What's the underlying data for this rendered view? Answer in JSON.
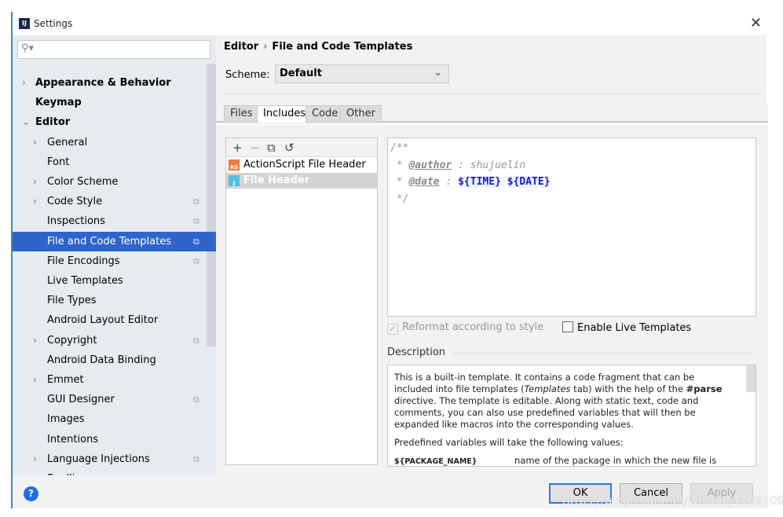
{
  "window": {
    "title": "Settings",
    "close": "✕"
  },
  "sidebar": {
    "search_placeholder": "",
    "items": [
      {
        "label": "Appearance & Behavior",
        "arrow": "›",
        "bold": true
      },
      {
        "label": "Keymap",
        "bold": true
      },
      {
        "label": "Editor",
        "arrow": "⌄",
        "bold": true
      },
      {
        "label": "General",
        "arrow": "›"
      },
      {
        "label": "Font"
      },
      {
        "label": "Color Scheme",
        "arrow": "›"
      },
      {
        "label": "Code Style",
        "arrow": "›",
        "copy": true
      },
      {
        "label": "Inspections",
        "copy": true
      },
      {
        "label": "File and Code Templates",
        "copy": true,
        "selected": true
      },
      {
        "label": "File Encodings",
        "copy": true
      },
      {
        "label": "Live Templates"
      },
      {
        "label": "File Types"
      },
      {
        "label": "Android Layout Editor"
      },
      {
        "label": "Copyright",
        "arrow": "›",
        "copy": true
      },
      {
        "label": "Android Data Binding"
      },
      {
        "label": "Emmet",
        "arrow": "›"
      },
      {
        "label": "GUI Designer",
        "copy": true
      },
      {
        "label": "Images"
      },
      {
        "label": "Intentions"
      },
      {
        "label": "Language Injections",
        "arrow": "›",
        "copy": true
      },
      {
        "label": "Spelling",
        "copy": true
      }
    ]
  },
  "main": {
    "breadcrumb": [
      "Editor",
      "File and Code Templates"
    ],
    "scheme_label": "Scheme:",
    "scheme_value": "Default",
    "tabs": [
      {
        "label": "Files"
      },
      {
        "label": "Includes",
        "active": true
      },
      {
        "label": "Code"
      },
      {
        "label": "Other"
      }
    ],
    "templates": [
      {
        "label": "ActionScript File Header",
        "icon": "AS",
        "color": "#f07b3f"
      },
      {
        "label": "File Header",
        "icon": "J",
        "color": "#5bbcdc",
        "selected": true
      }
    ],
    "code": {
      "open": "/**",
      "author_tag": "@author",
      "author_value": "shujuelin",
      "date_tag": "@date",
      "var1": "${TIME}",
      "var2": "${DATE}",
      "close": "*/"
    },
    "reformat_label": "Reformat according to style",
    "reformat_checked": true,
    "live_label": "Enable Live Templates",
    "live_checked": false,
    "description_label": "Description",
    "description": {
      "p1a": "This is a built-in template. It contains a code fragment that can be included into file templates (",
      "p1b": "Templates",
      "p1c": " tab) with the help of the ",
      "p1d": "#parse",
      "p1e": " directive. The template is editable. Along with static text, code and comments, you can also use predefined variables that will then be expanded like macros into the corresponding values.",
      "p2": "Predefined variables will take the following values:",
      "var_name": "${PACKAGE_NAME}",
      "var_desc": "name of the package in which the new file is"
    }
  },
  "buttons": {
    "help": "?",
    "ok": "OK",
    "cancel": "Cancel",
    "apply": "Apply"
  },
  "watermark": "https://blog.csdn.net/weixin_43691098"
}
